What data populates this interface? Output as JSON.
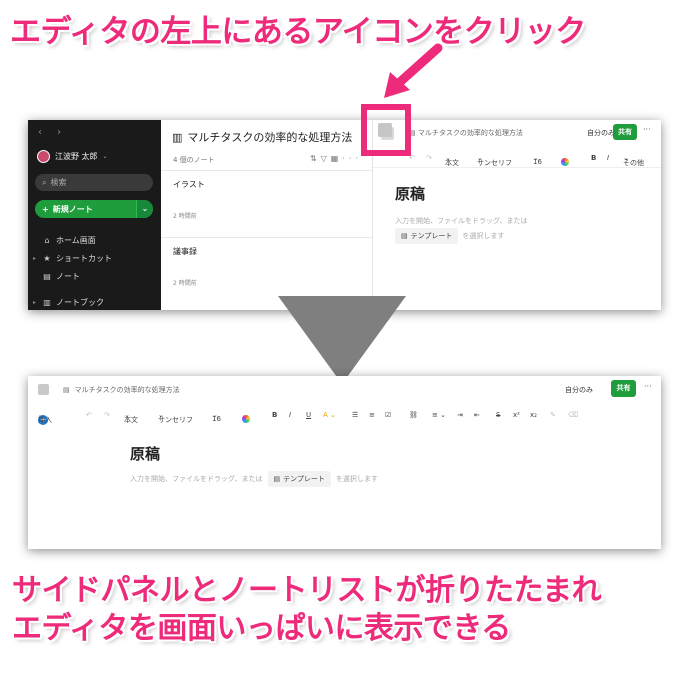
{
  "captions": {
    "top": "エディタの左上にあるアイコンをクリック",
    "bottom_line1": "サイドパネルとノートリストが折りたたまれ",
    "bottom_line2": "エディタを画面いっぱいに表示できる"
  },
  "colors": {
    "accent": "#ee2b7b",
    "green": "#1f9d3d",
    "sidebar_bg": "#1a1a1a"
  },
  "shot1": {
    "sidebar": {
      "user_name": "江波野 太郎",
      "search_placeholder": "検索",
      "new_note_label": "新規ノート",
      "menu": [
        {
          "label": "ホーム画面",
          "icon": "home-icon",
          "glyph": "⌂"
        },
        {
          "label": "ショートカット",
          "icon": "star-icon",
          "glyph": "★"
        },
        {
          "label": "ノート",
          "icon": "note-icon",
          "glyph": "▤"
        },
        {
          "label": "ノートブック",
          "icon": "notebook-icon",
          "glyph": "▥"
        }
      ]
    },
    "list": {
      "title": "マルチタスクの効率的な処理方法",
      "count": "4 個のノート",
      "notes": [
        {
          "title": "イラスト",
          "time": "2 時間前"
        },
        {
          "title": "議事録",
          "time": "2 時間前"
        }
      ]
    },
    "editor": {
      "breadcrumb": "マルチタスクの効率的な処理方法",
      "only_me": "自分のみ",
      "share": "共有",
      "more": "···",
      "toolbar": {
        "style": "本文",
        "font": "サンセリフ",
        "size": "16",
        "other": "その他"
      },
      "heading": "原稿",
      "placeholder_a": "入力を開始、ファイルをドラッグ、または",
      "template_chip": "テンプレート",
      "placeholder_b": "を選択します"
    }
  },
  "shot2": {
    "breadcrumb": "マルチタスクの効率的な処理方法",
    "only_me": "自分のみ",
    "share": "共有",
    "more": "···",
    "toolbar": {
      "insert": "挿入",
      "style": "本文",
      "font": "サンセリフ",
      "size": "16"
    },
    "heading": "原稿",
    "placeholder_a": "入力を開始、ファイルをドラッグ、または",
    "template_chip": "テンプレート",
    "placeholder_b": "を選択します"
  }
}
